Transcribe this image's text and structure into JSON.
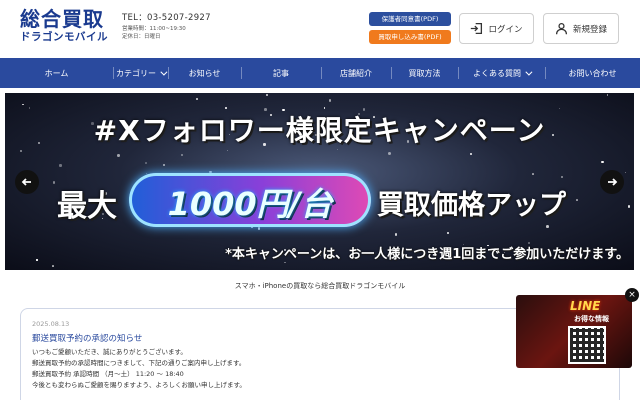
{
  "header": {
    "logo_main": "総合買取",
    "logo_sub": "ドラゴンモバイル",
    "tel": "TEL：03-5207-2927",
    "hours": "営業時間：11:00~19:30",
    "closed": "定休日：日曜日",
    "pdf_consent": "保護者同意書(PDF)",
    "pdf_application": "買取申し込み書(PDF)",
    "login": "ログイン",
    "register": "新規登録"
  },
  "nav": {
    "items": [
      {
        "label": "ホーム"
      },
      {
        "label": "カテゴリー"
      },
      {
        "label": "お知らせ"
      },
      {
        "label": "記事"
      },
      {
        "label": "店舗紹介"
      },
      {
        "label": "買取方法"
      },
      {
        "label": "よくある質問"
      },
      {
        "label": "お問い合わせ"
      }
    ]
  },
  "banner": {
    "title": "#Xフォロワー様限定キャンペーン",
    "left": "最大",
    "badge": "1000円/台",
    "right": "買取価格アップ",
    "note": "*本キャンペーンは、お一人様につき週1回までご参加いただけます。"
  },
  "tagline": "スマホ・iPhoneの買取なら総合買取ドラゴンモバイル",
  "news": {
    "date": "2025.08.13",
    "title": "郵送買取予約の承認の知らせ",
    "lines": [
      "いつもご愛顧いただき、誠にありがとうございます。",
      "郵送買取予約の承認時間につきまして、下記の通りご案内申し上げます。",
      "郵送買取予約 承認時間 （月〜土） 11:20 〜 18:40",
      "今後とも変わらぬご愛顧を賜りますよう、よろしくお願い申し上げます。"
    ]
  },
  "popup": {
    "title": "LINE",
    "subtitle": "お得な情報",
    "close": "×"
  }
}
